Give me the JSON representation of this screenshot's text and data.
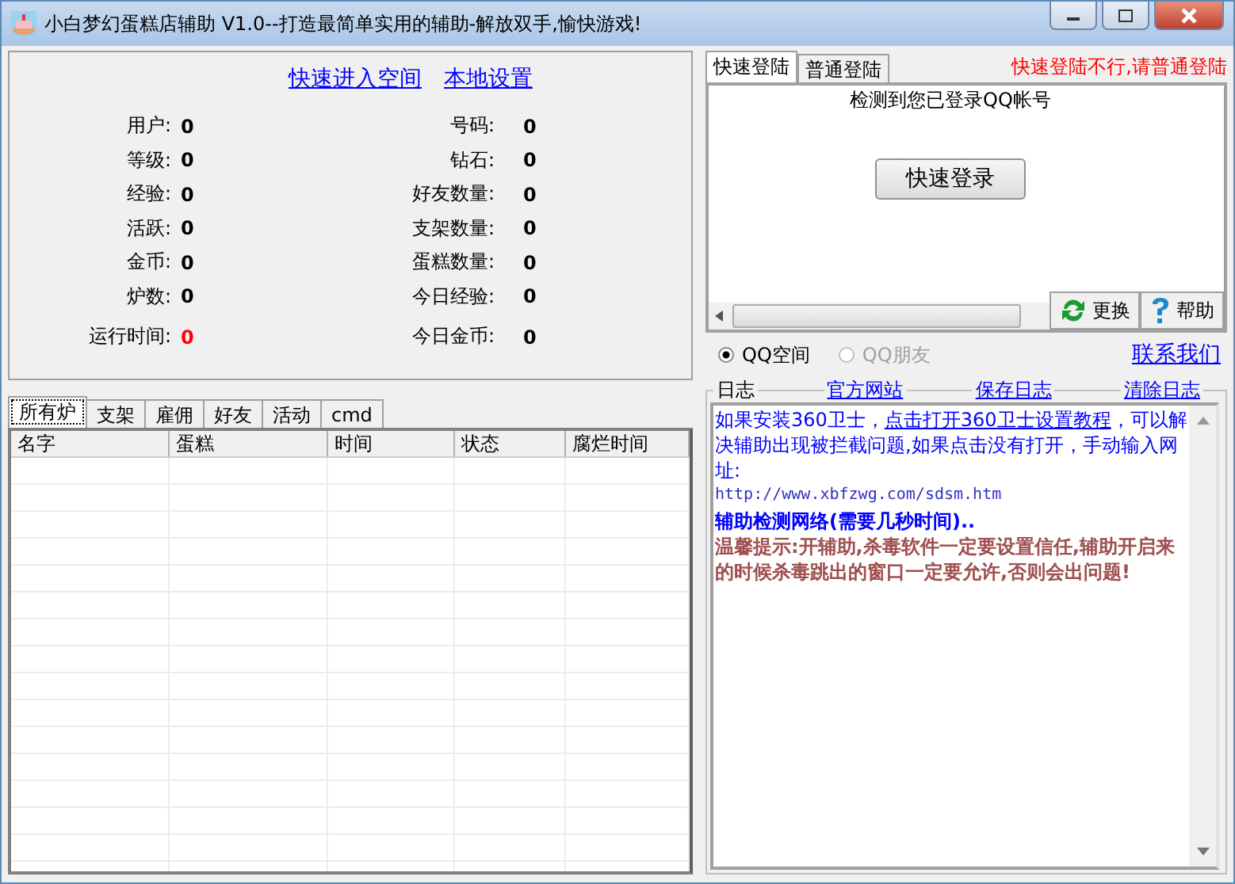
{
  "window": {
    "title": "小白梦幻蛋糕店辅助 V1.0--打造最简单实用的辅助-解放双手,愉快游戏!"
  },
  "top_links": [
    "快速进入空间",
    "本地设置"
  ],
  "stats_left": [
    {
      "label": "用户:",
      "value": "0",
      "highlight": false
    },
    {
      "label": "等级:",
      "value": "0",
      "highlight": false
    },
    {
      "label": "经验:",
      "value": "0",
      "highlight": false
    },
    {
      "label": "活跃:",
      "value": "0",
      "highlight": false
    },
    {
      "label": "金币:",
      "value": "0",
      "highlight": false
    },
    {
      "label": "炉数:",
      "value": "0",
      "highlight": false
    },
    {
      "label": "运行时间:",
      "value": "0",
      "highlight": true
    }
  ],
  "stats_right": [
    {
      "label": "号码:",
      "value": "0",
      "highlight": false
    },
    {
      "label": "钻石:",
      "value": "0",
      "highlight": false
    },
    {
      "label": "好友数量:",
      "value": "0",
      "highlight": false
    },
    {
      "label": "支架数量:",
      "value": "0",
      "highlight": false
    },
    {
      "label": "蛋糕数量:",
      "value": "0",
      "highlight": false
    },
    {
      "label": "今日经验:",
      "value": "0",
      "highlight": false
    },
    {
      "label": "今日金币:",
      "value": "0",
      "highlight": false
    }
  ],
  "login_tabs": [
    {
      "label": "快速登陆",
      "selected": true
    },
    {
      "label": "普通登陆",
      "selected": false
    }
  ],
  "login_hint": "快速登陆不行,请普通登陆",
  "login_panel": {
    "message": "检测到您已登录QQ帐号",
    "button": "快速登录",
    "actions": [
      "更换",
      "帮助"
    ]
  },
  "radios": [
    {
      "label": "QQ空间",
      "selected": true,
      "disabled": false
    },
    {
      "label": "QQ朋友",
      "selected": false,
      "disabled": true
    }
  ],
  "contact_link": "联系我们",
  "list_tabs": [
    {
      "label": "所有炉",
      "selected": true
    },
    {
      "label": "支架",
      "selected": false
    },
    {
      "label": "雇佣",
      "selected": false
    },
    {
      "label": "好友",
      "selected": false
    },
    {
      "label": "活动",
      "selected": false
    },
    {
      "label": "cmd",
      "selected": false
    }
  ],
  "table": {
    "columns": [
      "名字",
      "蛋糕",
      "时间",
      "状态",
      "腐烂时间"
    ]
  },
  "log": {
    "title": "日志",
    "links": [
      "官方网站",
      "保存日志",
      "清除日志"
    ],
    "entries": [
      {
        "kind": "notice",
        "before": "如果安装360卫士，",
        "link": "点击打开360卫士设置教程",
        "after": "，可以解决辅助出现被拦截问题,如果点击没有打开，手动输入网址:"
      },
      {
        "kind": "url",
        "text": "http://www.xbfzwg.com/sdsm.htm"
      },
      {
        "kind": "status",
        "text": "辅助检测网络(需要几秒时间).."
      },
      {
        "kind": "warning",
        "text": "温馨提示:开辅助,杀毒软件一定要设置信任,辅助开启来的时候杀毒跳出的窗口一定要允许,否则会出问题!"
      }
    ]
  }
}
